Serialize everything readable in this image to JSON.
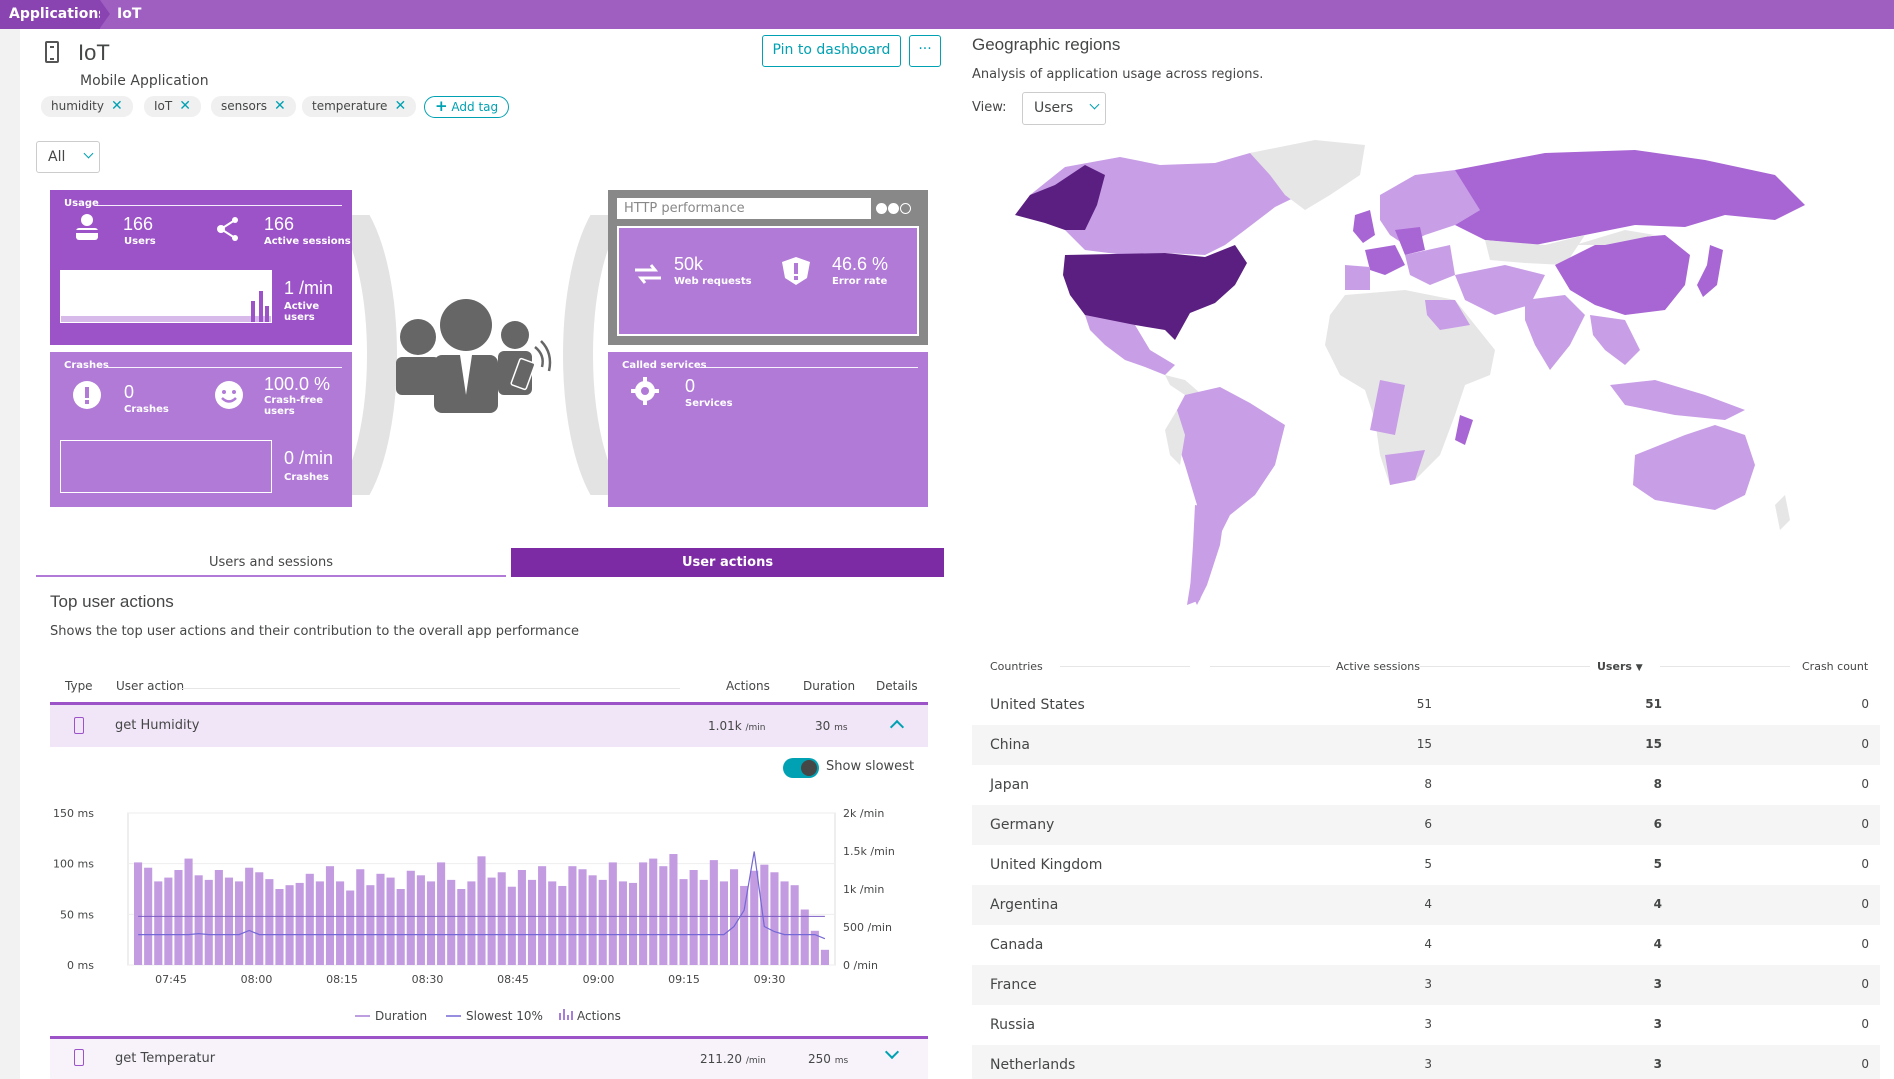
{
  "breadcrumb": {
    "root": "Applications",
    "current": "IoT"
  },
  "app": {
    "title": "IoT",
    "type": "Mobile Application"
  },
  "actions": {
    "pin_label": "Pin to dashboard",
    "more_label": "···"
  },
  "tags": [
    "humidity",
    "IoT",
    "sensors",
    "temperature"
  ],
  "add_tag_label": "Add tag",
  "filter": {
    "selected": "All"
  },
  "tiles": {
    "usage": {
      "label": "Usage",
      "users_value": "166",
      "users_label": "Users",
      "sessions_value": "166",
      "sessions_label": "Active sessions",
      "rate_value": "1 /min",
      "rate_label": "Active users"
    },
    "crashes": {
      "label": "Crashes",
      "crashes_value": "0",
      "crashes_label": "Crashes",
      "free_value": "100.0 %",
      "free_label": "Crash-free users",
      "rate_value": "0 /min",
      "rate_label": "Crashes"
    },
    "http": {
      "title": "HTTP performance",
      "requests_value": "50k",
      "requests_label": "Web requests",
      "error_value": "46.6 %",
      "error_label": "Error rate"
    },
    "called": {
      "label": "Called services",
      "value": "0",
      "value_label": "Services"
    }
  },
  "tabs": {
    "users_sessions": "Users and sessions",
    "user_actions": "User actions"
  },
  "top_actions": {
    "title": "Top user actions",
    "subtitle": "Shows the top user actions and their contribution to the overall app performance",
    "headers": {
      "type": "Type",
      "action": "User action",
      "actions": "Actions",
      "duration": "Duration",
      "details": "Details"
    },
    "rows": [
      {
        "name": "get Humidity",
        "actions": "1.01k",
        "actions_unit": "/min",
        "duration": "30",
        "duration_unit": "ms"
      },
      {
        "name": "get Temperatur",
        "actions": "211.20",
        "actions_unit": "/min",
        "duration": "250",
        "duration_unit": "ms"
      }
    ],
    "show_slowest": "Show slowest"
  },
  "chart_data": {
    "type": "bar",
    "x": [
      "07:45",
      "08:00",
      "08:15",
      "08:30",
      "08:45",
      "09:00",
      "09:15",
      "09:30"
    ],
    "y_left_ticks": [
      "150 ms",
      "100 ms",
      "50 ms",
      "0 ms"
    ],
    "y_right_ticks": [
      "2k /min",
      "1.5k /min",
      "1k /min",
      "500 /min",
      "0 /min"
    ],
    "y_left_range": [
      0,
      150
    ],
    "y_right_range": [
      0,
      2000
    ],
    "actions_per_min": [
      1350,
      1280,
      1100,
      1150,
      1250,
      1400,
      1180,
      1120,
      1250,
      1150,
      1100,
      1280,
      1220,
      1130,
      1000,
      1050,
      1080,
      1200,
      1100,
      1300,
      1100,
      980,
      1260,
      1050,
      1200,
      1150,
      1000,
      1240,
      1180,
      1100,
      1350,
      1120,
      1000,
      1100,
      1430,
      1150,
      1220,
      1030,
      1250,
      1120,
      1300,
      1100,
      1040,
      1300,
      1260,
      1180,
      1120,
      1350,
      1100,
      1080,
      1350,
      1400,
      1300,
      1460,
      1130,
      1250,
      1120,
      1380,
      1100,
      1260,
      1040,
      1240,
      1320,
      1220,
      1100,
      1050,
      730,
      450,
      200
    ],
    "duration_ms": [
      48,
      48,
      48,
      48,
      48,
      48,
      48,
      48,
      48,
      48,
      48,
      48,
      48,
      48,
      48,
      48,
      48,
      48,
      48,
      48,
      48,
      48,
      48,
      48,
      48,
      48,
      48,
      48,
      48,
      48,
      48,
      48,
      48,
      48,
      48,
      48,
      48,
      48,
      48,
      48,
      48,
      48,
      48,
      48,
      48,
      48,
      48,
      48,
      48,
      48,
      48,
      48,
      48,
      48,
      48,
      48,
      48,
      48,
      48,
      48,
      48,
      48,
      48,
      48,
      48,
      48,
      48,
      48,
      48
    ],
    "slowest_10pct_ms": [
      30,
      30,
      30,
      30,
      30,
      30,
      31,
      30,
      30,
      30,
      30,
      34,
      30,
      30,
      30,
      30,
      30,
      30,
      30,
      30,
      30,
      30,
      30,
      30,
      30,
      30,
      30,
      30,
      30,
      30,
      30,
      30,
      30,
      30,
      30,
      30,
      30,
      30,
      30,
      30,
      30,
      30,
      30,
      30,
      30,
      30,
      30,
      30,
      30,
      30,
      30,
      30,
      30,
      30,
      30,
      30,
      30,
      30,
      30,
      38,
      54,
      112,
      38,
      33,
      30,
      30,
      30,
      30,
      26
    ],
    "legend": [
      "Duration",
      "Slowest 10%",
      "Actions"
    ]
  },
  "geo": {
    "title": "Geographic regions",
    "subtitle": "Analysis of application usage across regions.",
    "view_label": "View:",
    "view_selected": "Users",
    "columns": [
      "Countries",
      "Active sessions",
      "Users",
      "Crash count"
    ],
    "sort_indicator": "▼",
    "rows": [
      {
        "country": "United States",
        "sessions": "51",
        "users": "51",
        "crashes": "0"
      },
      {
        "country": "China",
        "sessions": "15",
        "users": "15",
        "crashes": "0"
      },
      {
        "country": "Japan",
        "sessions": "8",
        "users": "8",
        "crashes": "0"
      },
      {
        "country": "Germany",
        "sessions": "6",
        "users": "6",
        "crashes": "0"
      },
      {
        "country": "United Kingdom",
        "sessions": "5",
        "users": "5",
        "crashes": "0"
      },
      {
        "country": "Argentina",
        "sessions": "4",
        "users": "4",
        "crashes": "0"
      },
      {
        "country": "Canada",
        "sessions": "4",
        "users": "4",
        "crashes": "0"
      },
      {
        "country": "France",
        "sessions": "3",
        "users": "3",
        "crashes": "0"
      },
      {
        "country": "Russia",
        "sessions": "3",
        "users": "3",
        "crashes": "0"
      },
      {
        "country": "Netherlands",
        "sessions": "3",
        "users": "3",
        "crashes": "0"
      }
    ]
  },
  "colors": {
    "accent": "#00a1b2",
    "purple_dark": "#7c2ba4",
    "purple": "#9c53c8",
    "purple_light": "#b07ad6",
    "map_high": "#5a1f80",
    "map_mid": "#a865d4",
    "map_low": "#c89ee6",
    "map_none": "#e6e6e6"
  }
}
